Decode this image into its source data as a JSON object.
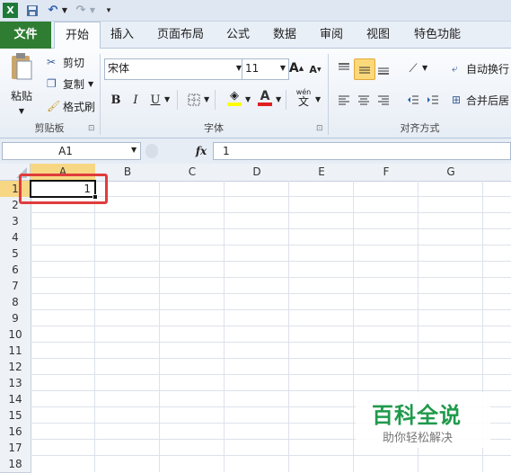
{
  "quick_access": {
    "app_icon": "excel-icon",
    "save_icon": "save-icon",
    "undo_icon": "undo-icon",
    "redo_icon": "redo-icon",
    "customize_icon": "customize-icon"
  },
  "tabs": [
    "文件",
    "开始",
    "插入",
    "页面布局",
    "公式",
    "数据",
    "审阅",
    "视图",
    "特色功能"
  ],
  "active_tab": "开始",
  "clipboard": {
    "paste": "粘贴",
    "cut": "剪切",
    "copy": "复制",
    "format_painter": "格式刷",
    "label": "剪贴板"
  },
  "font": {
    "name": "宋体",
    "size": "11",
    "label": "字体",
    "bold": "B",
    "italic": "I",
    "underline": "U",
    "grow": "A",
    "shrink": "A",
    "font_color_letter": "A",
    "phonetic": "wén",
    "phonetic_char": "文"
  },
  "alignment": {
    "wrap_text": "自动换行",
    "merge_center": "合并后居",
    "label": "对齐方式"
  },
  "formula_bar": {
    "name_box": "A1",
    "fx": "fx",
    "value": "1"
  },
  "sheet": {
    "columns": [
      "A",
      "B",
      "C",
      "D",
      "E",
      "F",
      "G"
    ],
    "rows": [
      "1",
      "2",
      "3",
      "4",
      "5",
      "6",
      "7",
      "8",
      "9",
      "10",
      "11",
      "12",
      "13",
      "14",
      "15",
      "16",
      "17",
      "18"
    ],
    "cell_A1": "1"
  },
  "watermark": {
    "title": "百科全说",
    "subtitle": "助你轻松解决"
  },
  "colors": {
    "file_tab": "#2f7d32",
    "highlight": "#e03c3c",
    "selected_header": "#f7d784"
  }
}
